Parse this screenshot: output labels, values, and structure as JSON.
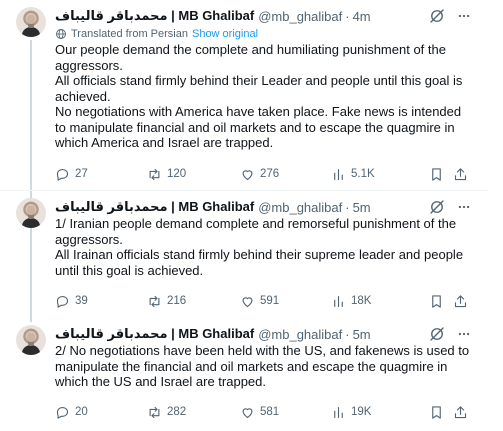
{
  "tweets": [
    {
      "display_name": "محمدباقر قالیباف | MB Ghalibaf",
      "handle": "@mb_ghalibaf",
      "dot": "·",
      "time": "4m",
      "translated_label": "Translated from Persian",
      "show_original": "Show original",
      "paragraphs": [
        "Our people demand the complete and humiliating punishment of the aggressors.",
        "All officials stand firmly behind their Leader and people until this goal is achieved.",
        "No negotiations with America have taken place. Fake news is intended to manipulate financial and oil markets and to escape the quagmire in which America and Israel are trapped."
      ],
      "replies": "27",
      "reposts": "120",
      "likes": "276",
      "views": "5.1K"
    },
    {
      "display_name": "محمدباقر قالیباف | MB Ghalibaf",
      "handle": "@mb_ghalibaf",
      "dot": "·",
      "time": "5m",
      "paragraphs": [
        "1/ Iranian people demand complete and remorseful punishment of the aggressors.",
        "All Irainan officials stand firmly behind their supreme leader and people until this goal is achieved."
      ],
      "replies": "39",
      "reposts": "216",
      "likes": "591",
      "views": "18K"
    },
    {
      "display_name": "محمدباقر قالیباف | MB Ghalibaf",
      "handle": "@mb_ghalibaf",
      "dot": "·",
      "time": "5m",
      "paragraphs": [
        "2/ No negotiations have been held with the US, and fakenews is used to manipulate the financial and oil markets and escape the quagmire in which the US and Israel are trapped."
      ],
      "replies": "20",
      "reposts": "282",
      "likes": "581",
      "views": "19K"
    }
  ],
  "colors": {
    "text": "#0f1419",
    "secondary": "#536471",
    "link": "#1d9bf0",
    "divider": "#eff3f4",
    "thread_line": "#cfd9de"
  },
  "icons": [
    "grok-icon",
    "more-icon",
    "globe-icon",
    "reply-icon",
    "repost-icon",
    "like-icon",
    "views-icon",
    "bookmark-icon",
    "share-icon"
  ]
}
